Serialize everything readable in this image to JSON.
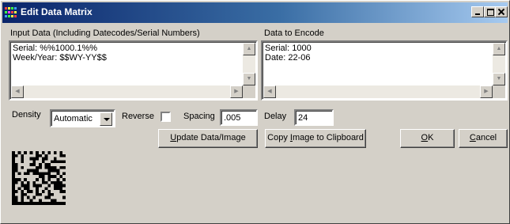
{
  "window": {
    "title": "Edit Data Matrix"
  },
  "input_panel": {
    "label": "Input Data (Including Datecodes/Serial Numbers)",
    "lines": [
      "Serial: %%1000.1%%",
      "Week/Year: $$WY-YY$$"
    ]
  },
  "encode_panel": {
    "label": "Data to Encode",
    "lines": [
      "Serial: 1000",
      "Date: 22-06"
    ]
  },
  "controls": {
    "density_label": "Density",
    "density_value": "Automatic",
    "reverse_label": "Reverse",
    "reverse_checked": false,
    "spacing_label": "Spacing",
    "spacing_value": ".005",
    "delay_label": "Delay",
    "delay_value": "24"
  },
  "buttons": {
    "update": {
      "prefix": "",
      "key": "U",
      "suffix": "pdate Data/Image"
    },
    "copy": {
      "prefix": "Copy ",
      "key": "I",
      "suffix": "mage to Clipboard"
    },
    "ok": {
      "prefix": "",
      "key": "O",
      "suffix": "K"
    },
    "cancel": {
      "prefix": "",
      "key": "C",
      "suffix": "ancel"
    }
  },
  "icons": {
    "app": "grid-icon",
    "minimize": "minimize-icon",
    "maximize": "maximize-icon",
    "close": "close-icon",
    "barcode": "data-matrix-barcode"
  },
  "colors": {
    "titlebar_start": "#0a246a",
    "titlebar_end": "#a6caf0",
    "face": "#d4d0c8"
  }
}
